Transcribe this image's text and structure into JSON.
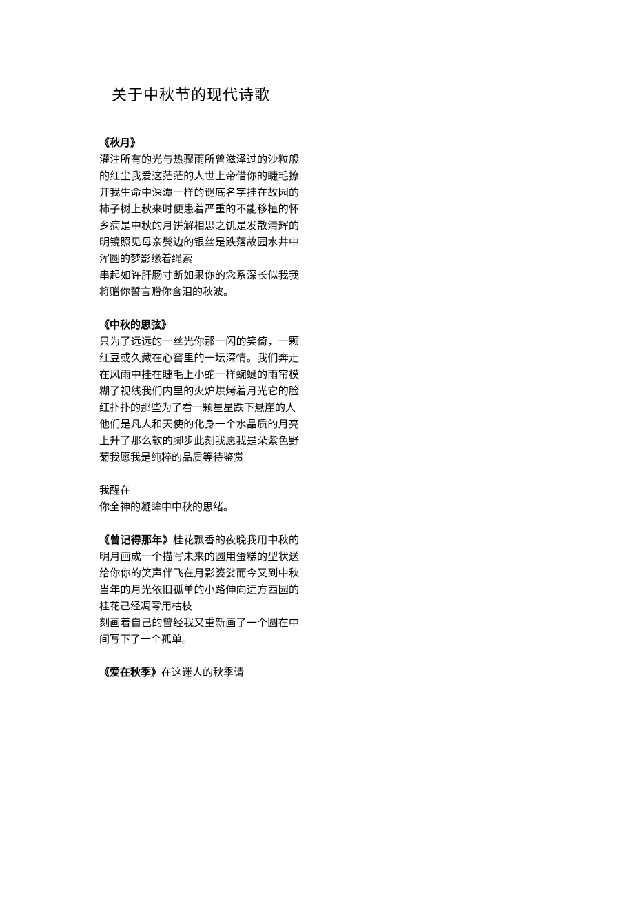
{
  "title": "关于中秋节的现代诗歌",
  "poems": [
    {
      "heading": "《秋月》",
      "stanzas": [
        "灌注所有的光与热骤雨所曾滋泽过的沙粒般的红尘我爱这茫茫的人世上帝借你的睫毛撩开我生命中深潭一样的谜底名字挂在故园的柿子树上秋来时便患着严重的不能移植的怀乡病是中秋的月饼解相思之饥是发散清辉的明镜照见母亲鬓边的银丝是跌落故园水井中浑圆的梦影缘着绳索",
        "串起如许肝肠寸断如果你的念系深长似我我将赠你誓言赠你含泪的秋波。"
      ]
    },
    {
      "heading": "《中秋的思弦》",
      "stanzas": [
        "只为了远远的一丝光你那一闪的笑倚，一颗红豆或久藏在心窖里的一坛深情。我们奔走在风雨中挂在睫毛上小蛇一样蜿蜒的雨帘模糊了视线我们内里的火炉烘烤着月光它的脸红扑扑的那些为了看一颗星星跌下悬崖的人",
        "他们是凡人和天使的化身一个水晶质的月亮上升了那么软的脚步此刻我愿我是朵紫色野菊我愿我是纯粹的品质等待鉴赏"
      ],
      "trailing_stanzas": [
        "我醒在",
        "你全神的凝眸中中秋的思绪。"
      ]
    },
    {
      "heading": "《曾记得那年》",
      "inline": true,
      "stanzas": [
        "桂花飘香的夜晚我用中秋的明月画成一个描写未来的圆用蛋糕的型状送给你你的笑声伴飞在月影婆娑而今又到中秋当年的月光依旧孤单的小路伸向远方西园的桂花己经凋零用枯枝",
        "刻画着自己的曾经我又重新画了一个圆在中间写下了一个孤单。"
      ]
    },
    {
      "heading": "《爱在秋季》",
      "inline": true,
      "stanzas": [
        "在这迷人的秋季请"
      ]
    }
  ]
}
